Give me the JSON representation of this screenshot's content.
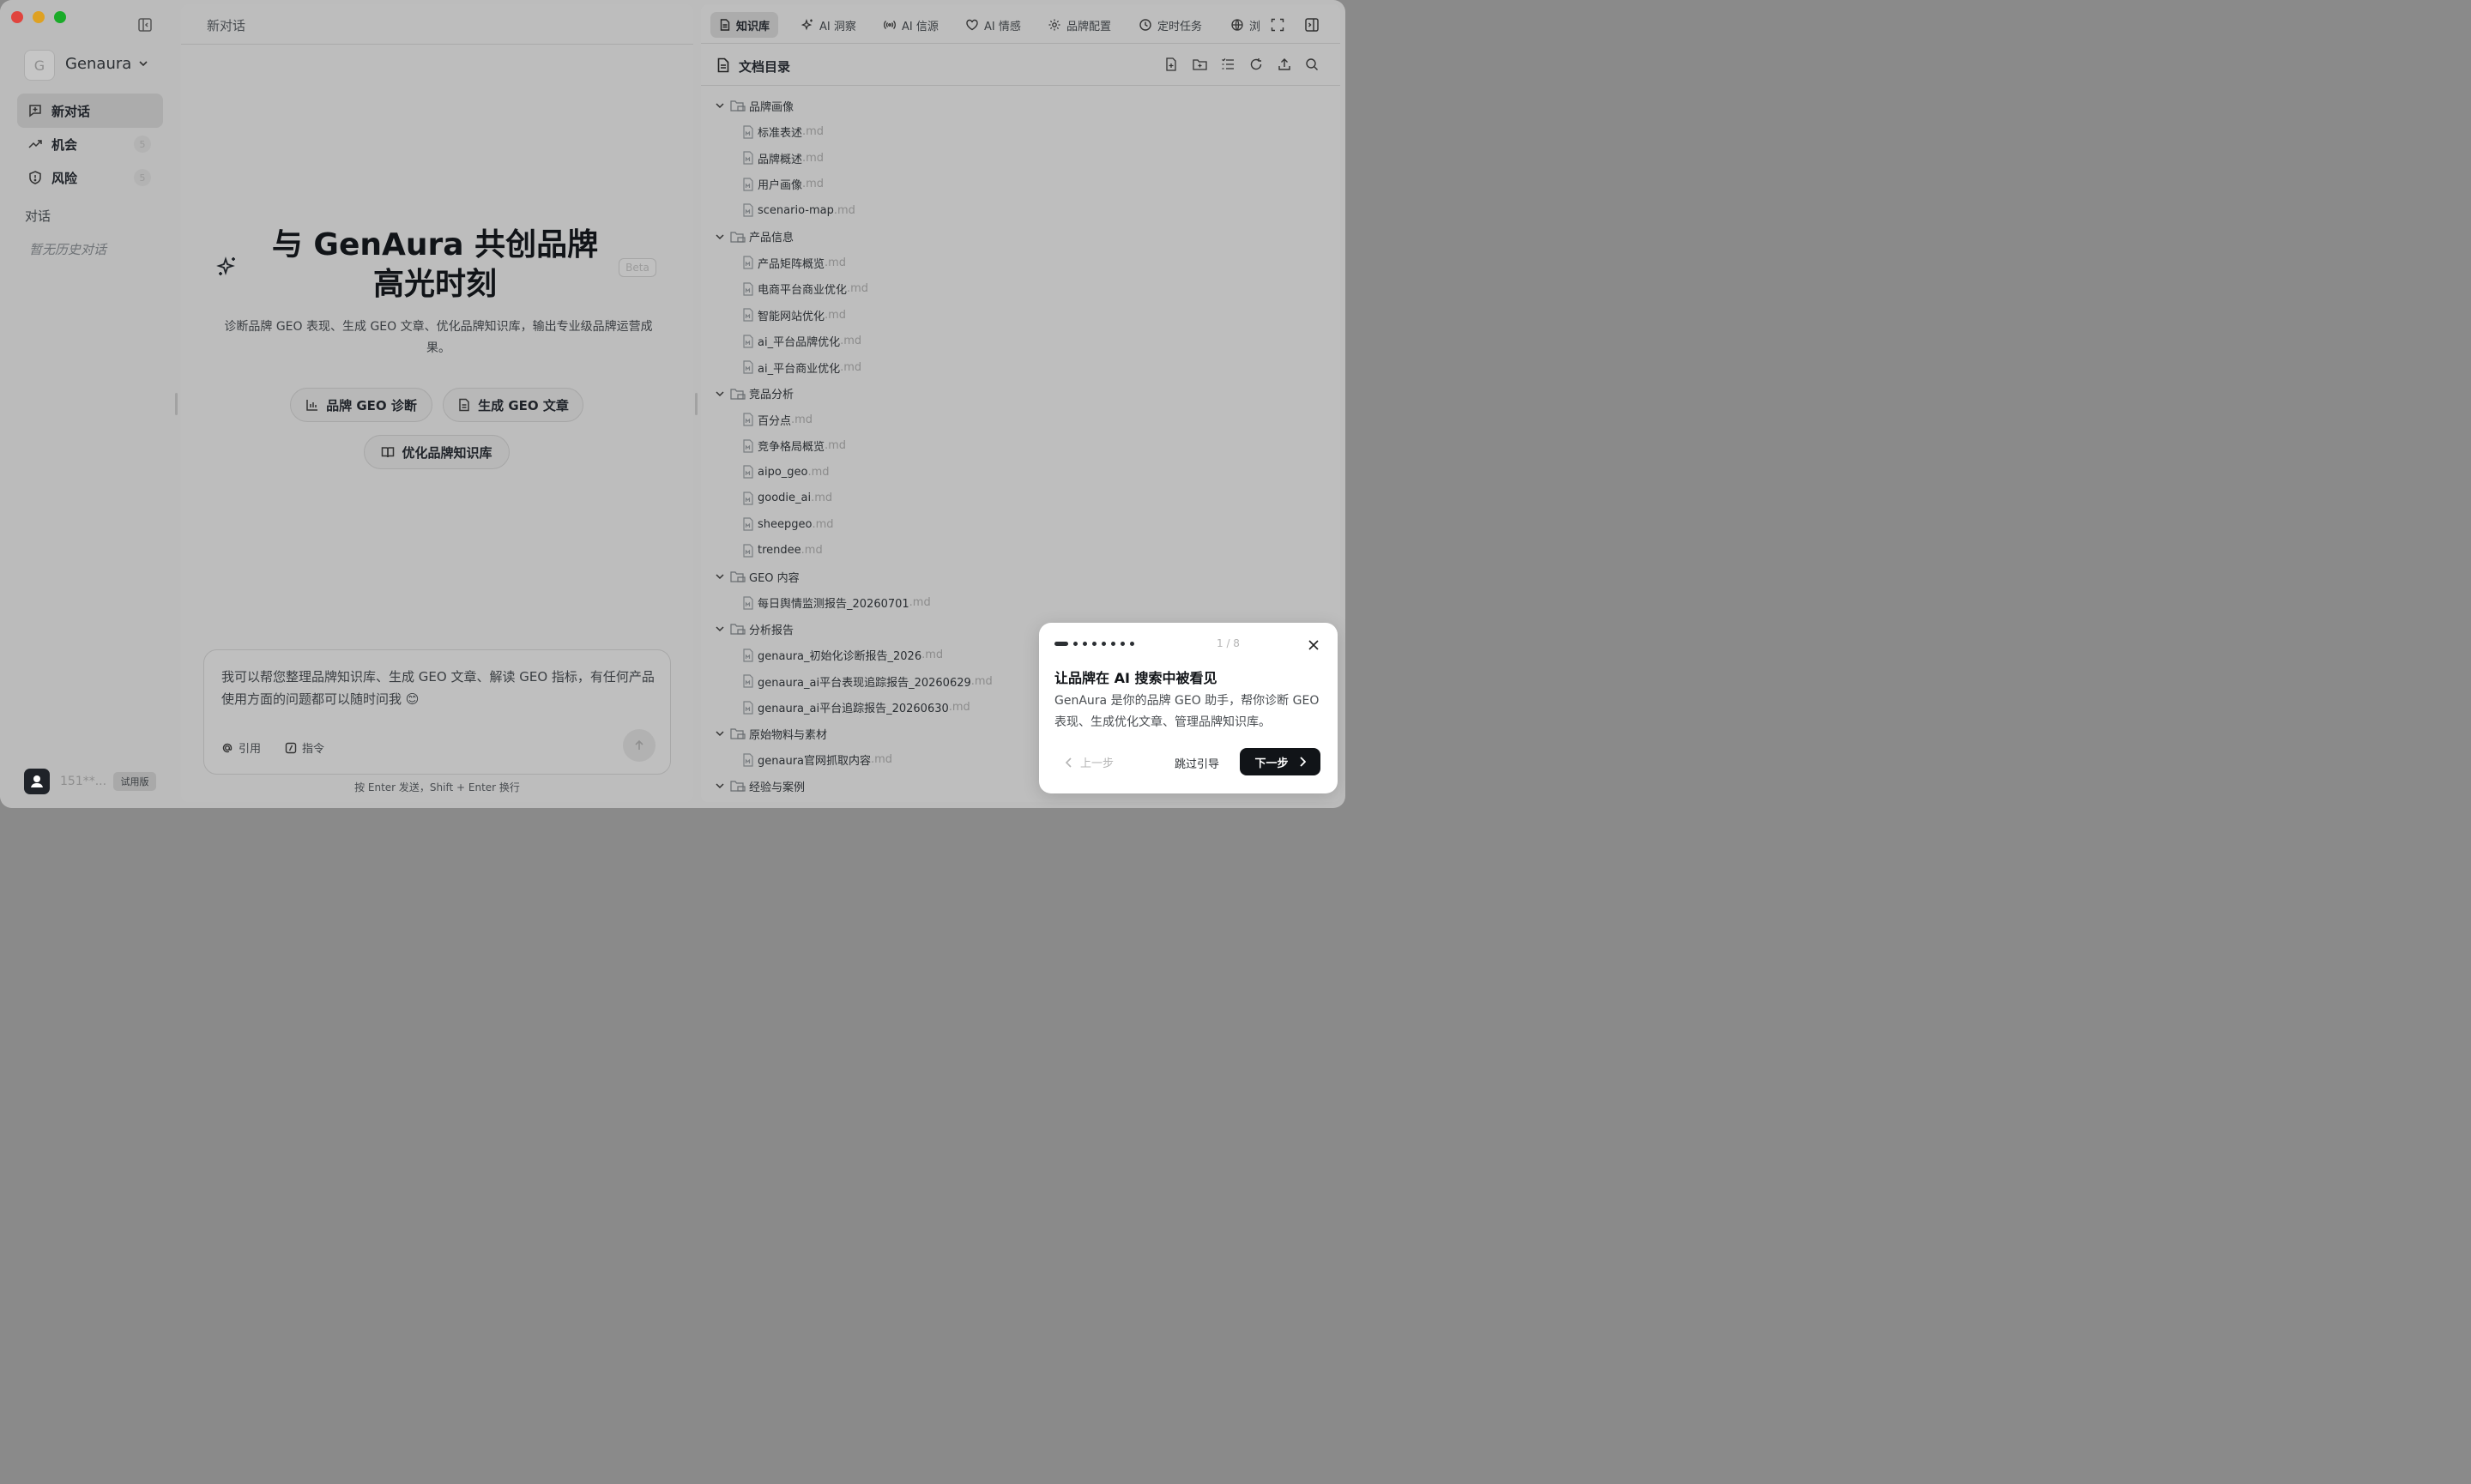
{
  "sidebar": {
    "brand_initial": "G",
    "brand_name": "Genaura",
    "nav": [
      {
        "label": "新对话",
        "icon": "new-chat-icon"
      },
      {
        "label": "机会",
        "count": "5",
        "icon": "trend-icon"
      },
      {
        "label": "风险",
        "count": "5",
        "icon": "shield-icon"
      }
    ],
    "section_label": "对话",
    "empty_history": "暂无历史对话",
    "user": "151**...",
    "plan_badge": "试用版"
  },
  "chat": {
    "title": "新对话",
    "hero_title": "与 GenAura 共创品牌高光时刻",
    "beta": "Beta",
    "hero_sub": "诊断品牌 GEO 表现、生成 GEO 文章、优化品牌知识库，输出专业级品牌运营成果。",
    "actions": [
      "品牌 GEO 诊断",
      "生成 GEO 文章",
      "优化品牌知识库"
    ],
    "input_placeholder": "我可以帮您整理品牌知识库、生成 GEO 文章、解读 GEO 指标，有任何产品使用方面的问题都可以随时问我 😊",
    "tool_quote": "引用",
    "tool_command": "指令",
    "hint": "按 Enter 发送，Shift + Enter 换行"
  },
  "right": {
    "tabs": [
      "知识库",
      "AI 洞察",
      "AI 信源",
      "AI 情感",
      "品牌配置",
      "定时任务",
      "浏"
    ],
    "doc_title": "文档目录",
    "tree": [
      {
        "type": "folder",
        "name": "品牌画像"
      },
      {
        "type": "file",
        "name": "标准表述",
        "ext": ".md"
      },
      {
        "type": "file",
        "name": "品牌概述",
        "ext": ".md"
      },
      {
        "type": "file",
        "name": "用户画像",
        "ext": ".md"
      },
      {
        "type": "file",
        "name": "scenario-map",
        "ext": ".md"
      },
      {
        "type": "folder",
        "name": "产品信息"
      },
      {
        "type": "file",
        "name": "产品矩阵概览",
        "ext": ".md"
      },
      {
        "type": "file",
        "name": "电商平台商业优化",
        "ext": ".md"
      },
      {
        "type": "file",
        "name": "智能网站优化",
        "ext": ".md"
      },
      {
        "type": "file",
        "name": "ai_平台品牌优化",
        "ext": ".md"
      },
      {
        "type": "file",
        "name": "ai_平台商业优化",
        "ext": ".md"
      },
      {
        "type": "folder",
        "name": "竞品分析"
      },
      {
        "type": "file",
        "name": "百分点",
        "ext": ".md"
      },
      {
        "type": "file",
        "name": "竞争格局概览",
        "ext": ".md"
      },
      {
        "type": "file",
        "name": "aipo_geo",
        "ext": ".md"
      },
      {
        "type": "file",
        "name": "goodie_ai",
        "ext": ".md"
      },
      {
        "type": "file",
        "name": "sheepgeo",
        "ext": ".md"
      },
      {
        "type": "file",
        "name": "trendee",
        "ext": ".md"
      },
      {
        "type": "folder",
        "name": "GEO 内容"
      },
      {
        "type": "file",
        "name": "每日舆情监测报告_20260701",
        "ext": ".md"
      },
      {
        "type": "folder",
        "name": "分析报告"
      },
      {
        "type": "file",
        "name": "genaura_初始化诊断报告_2026",
        "ext": ".md"
      },
      {
        "type": "file",
        "name": "genaura_ai平台表现追踪报告_20260629",
        "ext": ".md"
      },
      {
        "type": "file",
        "name": "genaura_ai平台追踪报告_20260630",
        "ext": ".md"
      },
      {
        "type": "folder",
        "name": "原始物料与素材"
      },
      {
        "type": "file",
        "name": "genaura官网抓取内容",
        "ext": ".md"
      },
      {
        "type": "folder",
        "name": "经验与案例"
      }
    ]
  },
  "tour": {
    "step": "1 / 8",
    "title": "让品牌在 AI 搜索中被看见",
    "desc": "GenAura 是你的品牌 GEO 助手，帮你诊断 GEO 表现、生成优化文章、管理品牌知识库。",
    "prev": "上一步",
    "skip": "跳过引导",
    "next": "下一步"
  }
}
